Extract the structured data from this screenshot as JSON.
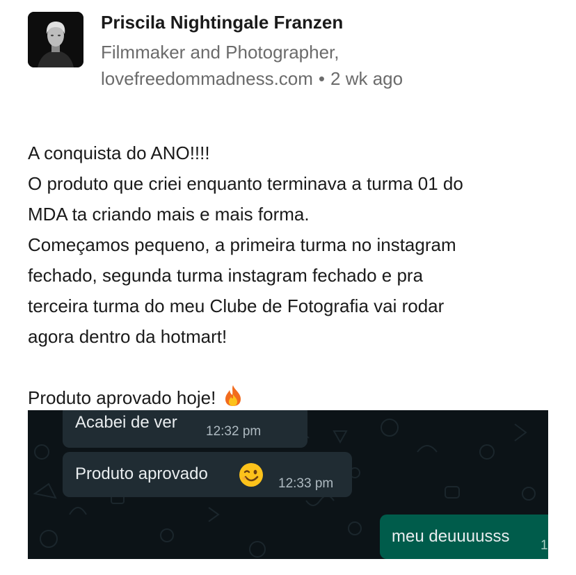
{
  "author": {
    "name": "Priscila Nightingale Franzen",
    "headline": "Filmmaker and Photographer,",
    "website": "lovefreedommadness.com",
    "separator": "•",
    "time_ago": "2 wk ago"
  },
  "post": {
    "lines": [
      "A conquista do ANO!!!!",
      "O produto que criei enquanto terminava a turma 01 do",
      "MDA ta criando mais e mais forma.",
      "Começamos pequeno, a primeira turma no instagram",
      "fechado, segunda turma instagram fechado e pra",
      "terceira turma do meu Clube de Fotografia vai rodar",
      "agora dentro da hotmart!"
    ],
    "closing": "Produto aprovado hoje!",
    "closing_icon": "fire-icon"
  },
  "chat": {
    "messages": [
      {
        "direction": "incoming",
        "text": "Acabei de ver",
        "time": "12:32 pm"
      },
      {
        "direction": "incoming",
        "text": "Produto aprovado",
        "icon": "winking-face-icon",
        "time": "12:33 pm"
      },
      {
        "direction": "outgoing",
        "text": "meu deuuuusss",
        "time": "1"
      }
    ],
    "colors": {
      "background": "#0c1317",
      "incoming_bubble": "#202c33",
      "outgoing_bubble": "#005c4b"
    }
  }
}
